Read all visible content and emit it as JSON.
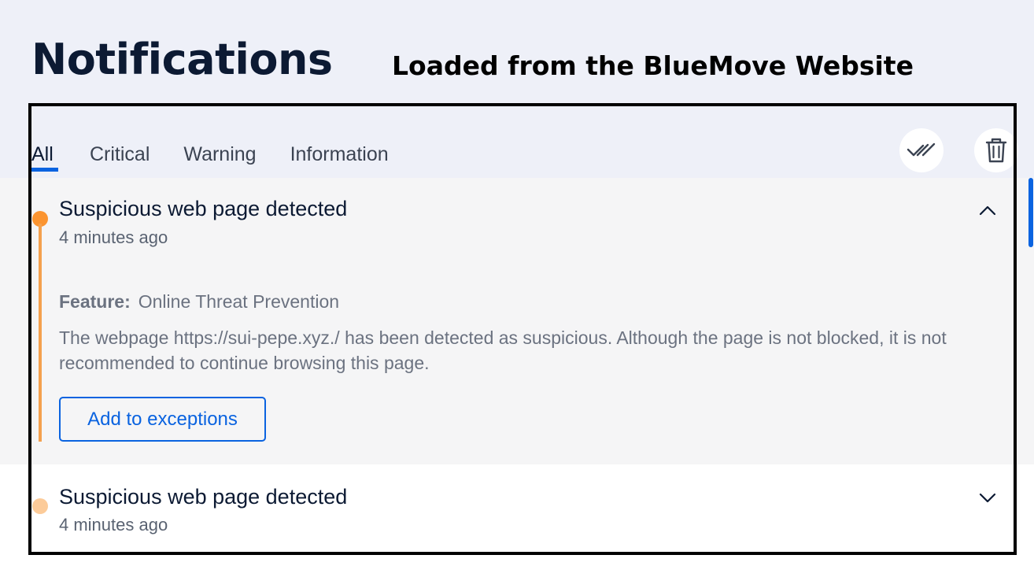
{
  "page": {
    "title": "Notifications",
    "annotation_caption": "Loaded from the BlueMove Website"
  },
  "tabs": [
    {
      "label": "All",
      "active": true
    },
    {
      "label": "Critical",
      "active": false
    },
    {
      "label": "Warning",
      "active": false
    },
    {
      "label": "Information",
      "active": false
    }
  ],
  "toolbar": {
    "mark_all_read_icon": "double-check-icon",
    "delete_icon": "trash-icon"
  },
  "notifications": [
    {
      "title": "Suspicious web page detected",
      "time": "4 minutes ago",
      "expanded": true,
      "severity_color": "#fb9430",
      "feature_label": "Feature:",
      "feature_value": "Online Threat Prevention",
      "description": "The webpage https://sui-pepe.xyz./ has been detected as suspicious. Although the page is not blocked, it is not recommended to continue browsing this page.",
      "action_label": "Add to exceptions"
    },
    {
      "title": "Suspicious web page detected",
      "time": "4 minutes ago",
      "expanded": false,
      "severity_color": "#fccb99"
    }
  ],
  "colors": {
    "accent": "#0a63e0",
    "warning": "#fb9430",
    "header_background": "#eef0f8",
    "expanded_background": "#f5f5f6"
  }
}
